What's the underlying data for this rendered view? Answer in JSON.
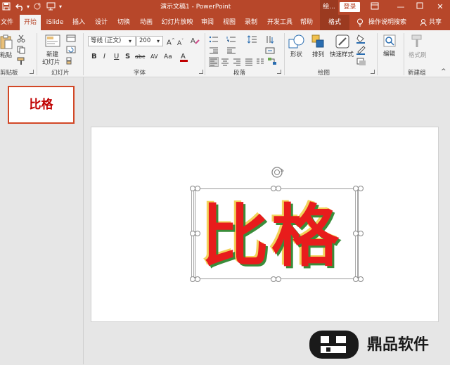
{
  "titlebar": {
    "save_icon": "save-icon",
    "undo_icon": "undo-icon",
    "redo_icon": "redo-icon",
    "customize_icon": "customize-quick-access-icon",
    "doc_title": "演示文稿1 - PowerPoint",
    "context_label": "绘...",
    "login_label": "登录"
  },
  "tabs": [
    {
      "label": "文件"
    },
    {
      "label": "开始"
    },
    {
      "label": "iSlide"
    },
    {
      "label": "插入"
    },
    {
      "label": "设计"
    },
    {
      "label": "切换"
    },
    {
      "label": "动画"
    },
    {
      "label": "幻灯片放映"
    },
    {
      "label": "审阅"
    },
    {
      "label": "视图"
    },
    {
      "label": "录制"
    },
    {
      "label": "开发工具"
    },
    {
      "label": "帮助"
    },
    {
      "label": "格式"
    }
  ],
  "tell_me": "操作说明搜索",
  "share": "共享",
  "ribbon": {
    "clipboard": {
      "paste_label": "粘贴",
      "group_label": "剪贴板"
    },
    "slides": {
      "new_slide_label_1": "新建",
      "new_slide_label_2": "幻灯片",
      "group_label": "幻灯片"
    },
    "font": {
      "font_name": "等线 (正文)",
      "font_size": "200",
      "bold": "B",
      "italic": "I",
      "underline": "U",
      "shadow": "S",
      "strike": "abc",
      "spacing": "AV",
      "case": "Aa",
      "group_label": "字体"
    },
    "paragraph": {
      "group_label": "段落"
    },
    "drawing": {
      "shapes_label": "形状",
      "arrange_label": "排列",
      "quick_styles_label": "快速样式",
      "group_label": "绘图"
    },
    "editing": {
      "edit_label": "编辑"
    },
    "new_group": {
      "format_painter_label": "格式刷",
      "group_label": "新建组"
    }
  },
  "thumbnail": {
    "text": "比格"
  },
  "slide": {
    "text": "比格"
  },
  "watermark": {
    "text": "鼎品软件"
  },
  "colors": {
    "accent": "#b7472a",
    "text_red": "#e81c1c",
    "shadow_green": "#3a8d3a",
    "outline_yellow": "#f2d35b"
  }
}
